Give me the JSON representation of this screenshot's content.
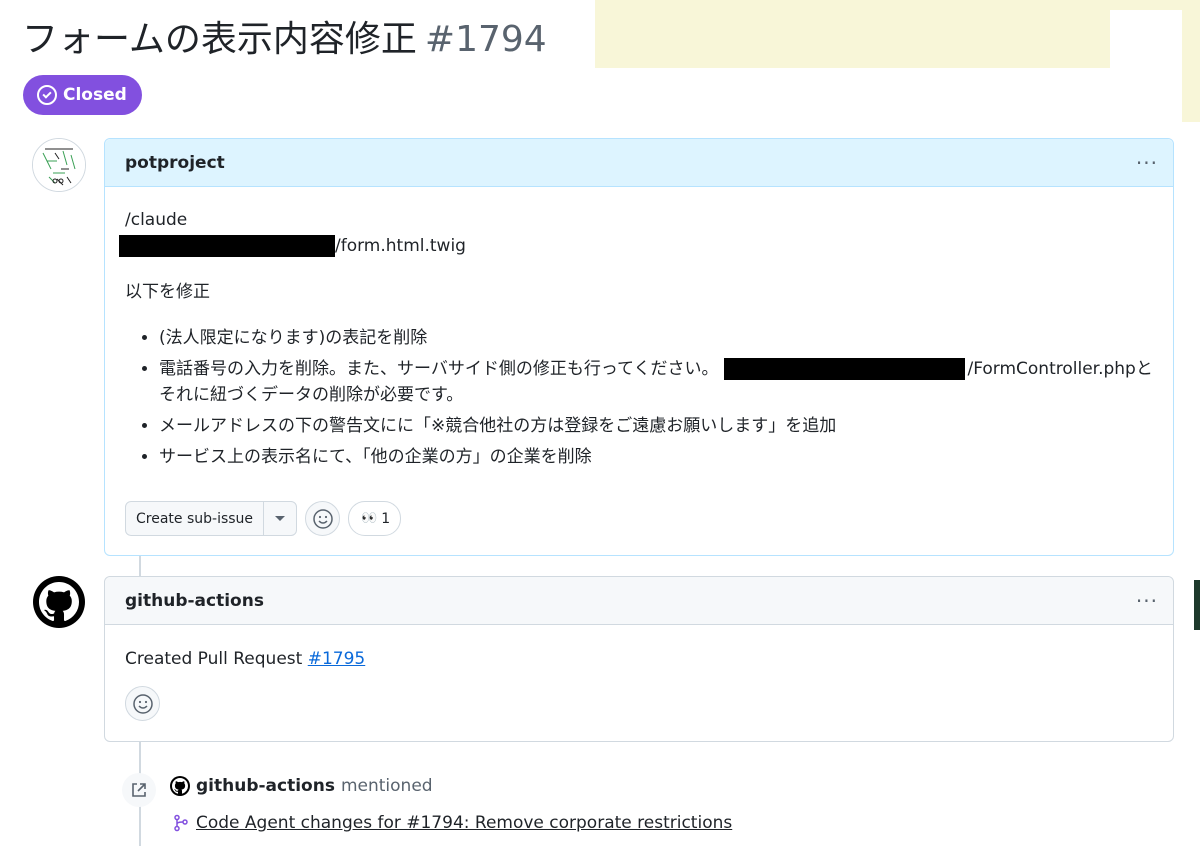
{
  "issue": {
    "title": "フォームの表示内容修正",
    "number": "#1794",
    "state": "Closed",
    "state_color": "#8250df"
  },
  "comments": [
    {
      "author": "potproject",
      "menu_icon": "kebab-horizontal-icon",
      "lines": {
        "command": "/claude",
        "file_path_suffix": "/form.html.twig",
        "intro": "以下を修正"
      },
      "items": [
        "(法人限定になります)の表記を削除",
        {
          "before_redaction": "電話番号の入力を削除。また、サーバサイド側の修正も行ってください。",
          "after_redaction": "/FormController.phpとそれに紐づくデータの削除が必要です。"
        },
        "メールアドレスの下の警告文にに「※競合他社の方は登録をご遠慮お願いします」を追加",
        "サービス上の表示名にて、「他の企業の方」の企業を削除"
      ],
      "create_sub_issue_label": "Create sub-issue",
      "reaction": {
        "emoji": "👀",
        "count": "1"
      }
    },
    {
      "author": "github-actions",
      "menu_icon": "kebab-horizontal-icon",
      "body_prefix": "Created Pull Request",
      "pr_link": "#1795"
    }
  ],
  "mention_event": {
    "author": "github-actions",
    "verb": "mentioned",
    "pr_title": "Code Agent changes for #1794: Remove corporate restrictions"
  },
  "colors": {
    "accent_link": "#0969da",
    "comment_header_highlight": "#ddf4ff",
    "border": "#d1d9e0"
  }
}
